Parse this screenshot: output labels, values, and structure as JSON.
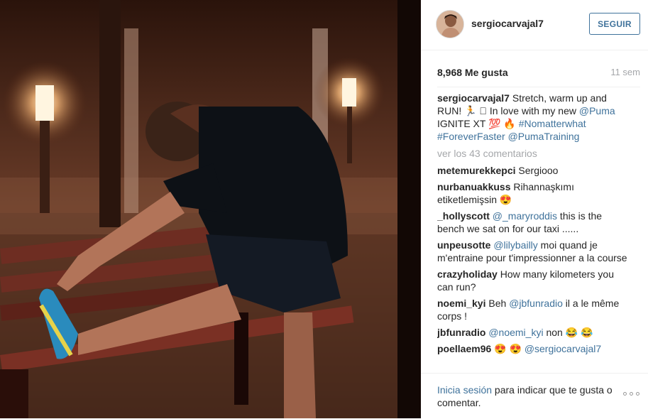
{
  "post": {
    "username": "sergiocarvajal7",
    "follow_label": "SEGUIR",
    "likes": "8,968 Me gusta",
    "age": "11 sem"
  },
  "caption": {
    "username": "sergiocarvajal7",
    "text_1": " Stretch, warm up and RUN! 🏃 🏽 In love with my new ",
    "tag_puma": "@Puma",
    "text_2": " IGNITE XT 💯 🔥 ",
    "tag_nomatter": "#Nomatterwhat",
    "text_3": " ",
    "tag_forever": "#ForeverFaster",
    "text_4": " ",
    "tag_pumatraining": "@PumaTraining"
  },
  "view_comments": "ver los 43 comentarios",
  "comments": [
    {
      "user": "metemurekkepci",
      "parts": [
        {
          "t": " Sergiooo"
        }
      ]
    },
    {
      "user": "nurbanuakkuss",
      "parts": [
        {
          "t": " Rihannaşkımı etiketlemişsin 😍"
        }
      ]
    },
    {
      "user": "_hollyscott",
      "parts": [
        {
          "t": " "
        },
        {
          "tag": "@_maryroddis"
        },
        {
          "t": " this is the bench we sat on for our taxi ......"
        }
      ]
    },
    {
      "user": "unpeusotte",
      "parts": [
        {
          "t": " "
        },
        {
          "tag": "@lilybailly"
        },
        {
          "t": " moi quand je m'entraine pour t'impressionner a la course"
        }
      ]
    },
    {
      "user": "crazyholiday",
      "parts": [
        {
          "t": " How many kilometers you can run?"
        }
      ]
    },
    {
      "user": "noemi_kyi",
      "parts": [
        {
          "t": " Beh "
        },
        {
          "tag": "@jbfunradio"
        },
        {
          "t": " il a le même corps !"
        }
      ]
    },
    {
      "user": "jbfunradio",
      "parts": [
        {
          "t": " "
        },
        {
          "tag": "@noemi_kyi"
        },
        {
          "t": " non 😂 😂"
        }
      ]
    },
    {
      "user": "poellaem96",
      "parts": [
        {
          "t": " 😍 😍 "
        },
        {
          "tag": "@sergiocarvajal7"
        }
      ]
    }
  ],
  "footer": {
    "login_link": "Inicia sesión",
    "login_text": " para indicar que te gusta o comentar."
  },
  "colors": {
    "link_blue": "#3f729b",
    "muted_grey": "#a5a7aa",
    "text": "#262626"
  },
  "icons": {
    "more_options": "three-dots-icon"
  }
}
